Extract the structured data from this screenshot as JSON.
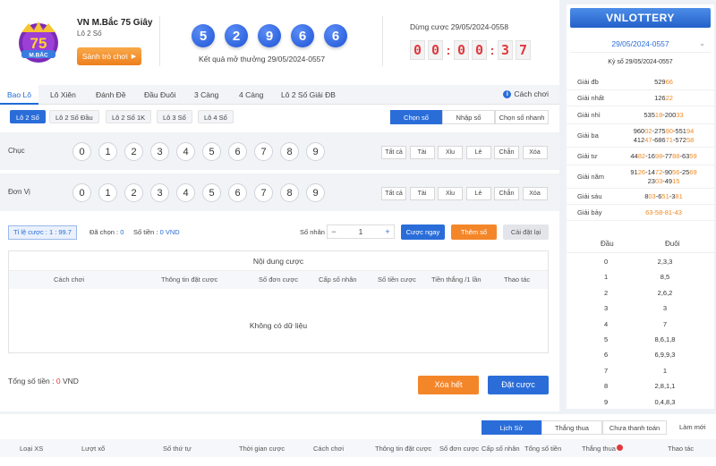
{
  "header": {
    "game_title": "VN M.Bắc 75 Giây",
    "game_sub": "Lô 2 Số",
    "lobby_btn": "Sảnh trò chơi",
    "logo_text": "75",
    "logo_sub": "M.BẮC",
    "balls": [
      "5",
      "2",
      "9",
      "6",
      "6"
    ],
    "result_text": "Kết quả mở thưởng 29/05/2024-0557",
    "stop_label": "Dừng cược 29/05/2024-0558",
    "countdown": [
      "0",
      "0",
      "0",
      "0",
      "3",
      "7"
    ]
  },
  "tabs": [
    {
      "label": "Bao Lô",
      "active": true
    },
    {
      "label": "Lô Xiên"
    },
    {
      "label": "Đánh Đề"
    },
    {
      "label": "Đầu Đuôi"
    },
    {
      "label": "3 Càng"
    },
    {
      "label": "4 Càng"
    },
    {
      "label": "Lô 2 Số Giải ĐB"
    }
  ],
  "howto": "Cách chơi",
  "subtabs": [
    {
      "label": "Lô 2 Số",
      "active": true
    },
    {
      "label": "Lô 2 Số Đầu"
    },
    {
      "label": "Lô 2 Số 1K"
    },
    {
      "label": "Lô 3 Số"
    },
    {
      "label": "Lô 4 Số"
    }
  ],
  "modes": [
    {
      "label": "Chọn số",
      "active": true
    },
    {
      "label": "Nhập số"
    },
    {
      "label": "Chọn số nhanh"
    }
  ],
  "rows": [
    {
      "label": "Chục",
      "numbers": [
        "0",
        "1",
        "2",
        "3",
        "4",
        "5",
        "6",
        "7",
        "8",
        "9"
      ]
    },
    {
      "label": "Đơn Vị",
      "numbers": [
        "0",
        "1",
        "2",
        "3",
        "4",
        "5",
        "6",
        "7",
        "8",
        "9"
      ]
    }
  ],
  "quick_buttons": [
    "Tất cả",
    "Tài",
    "Xỉu",
    "Lẻ",
    "Chẵn",
    "Xóa"
  ],
  "controls": {
    "ratio": "Tỉ lệ cược : 1 : 99.7",
    "selected_label": "Đã chọn : ",
    "selected_val": "0",
    "amount_label": "Số tiền : ",
    "amount_val": "0 VND",
    "multiplier_label": "Số nhân :",
    "minus": "−",
    "multiplier": "1",
    "plus": "+",
    "bet_now": "Cược ngay",
    "add_number": "Thêm số",
    "reset": "Cài đặt lại"
  },
  "content": {
    "title": "Nội dung cược",
    "headers": [
      "Cách chơi",
      "Thông tin đặt cược",
      "Số đơn cược",
      "Cấp số nhân",
      "Số tiền cược",
      "Tiền thắng /1 lần",
      "Thao tác"
    ],
    "empty": "Không có dữ liệu"
  },
  "footer": {
    "total_label": "Tổng số tiền : ",
    "total_val": "0",
    "total_unit": " VND",
    "clear_all": "Xóa hết",
    "place_bet": "Đặt cược"
  },
  "right": {
    "logo": "VNLOTTERY",
    "date": "29/05/2024-0557",
    "kyso": "Kỳ số 29/05/2024-0557",
    "prizes": [
      {
        "name": "Giải đb",
        "lines": [
          [
            [
              "529",
              ""
            ],
            [
              "66",
              "hl"
            ]
          ]
        ]
      },
      {
        "name": "Giải nhất",
        "lines": [
          [
            [
              "126",
              ""
            ],
            [
              "22",
              "hl"
            ]
          ]
        ]
      },
      {
        "name": "Giải nhì",
        "lines": [
          [
            [
              "535",
              ""
            ],
            [
              "18",
              "hl"
            ],
            [
              "-",
              ""
            ],
            [
              "200",
              ""
            ],
            [
              "33",
              "hl"
            ]
          ]
        ]
      },
      {
        "name": "Giải ba",
        "lines": [
          [
            [
              "960",
              ""
            ],
            [
              "02",
              "hl"
            ],
            [
              "-",
              ""
            ],
            [
              "275",
              ""
            ],
            [
              "90",
              "hl"
            ],
            [
              "-",
              ""
            ],
            [
              "551",
              ""
            ],
            [
              "94",
              "hl"
            ]
          ],
          [
            [
              "412",
              ""
            ],
            [
              "47",
              "hl"
            ],
            [
              "-",
              ""
            ],
            [
              "686",
              ""
            ],
            [
              "71",
              "hl"
            ],
            [
              "-",
              ""
            ],
            [
              "572",
              ""
            ],
            [
              "58",
              "hl"
            ]
          ]
        ]
      },
      {
        "name": "Giải tư",
        "lines": [
          [
            [
              "44",
              ""
            ],
            [
              "82",
              "hl"
            ],
            [
              "-",
              ""
            ],
            [
              "16",
              ""
            ],
            [
              "98",
              "hl"
            ],
            [
              "-",
              ""
            ],
            [
              "77",
              ""
            ],
            [
              "88",
              "hl"
            ],
            [
              "-",
              ""
            ],
            [
              "63",
              ""
            ],
            [
              "59",
              "hl"
            ]
          ]
        ]
      },
      {
        "name": "Giải năm",
        "lines": [
          [
            [
              "91",
              ""
            ],
            [
              "26",
              "hl"
            ],
            [
              "-",
              ""
            ],
            [
              "14",
              ""
            ],
            [
              "72",
              "hl"
            ],
            [
              "-",
              ""
            ],
            [
              "90",
              ""
            ],
            [
              "56",
              "hl"
            ],
            [
              "-",
              ""
            ],
            [
              "25",
              ""
            ],
            [
              "69",
              "hl"
            ]
          ],
          [
            [
              "23",
              ""
            ],
            [
              "03",
              "hl"
            ],
            [
              "-",
              ""
            ],
            [
              "49",
              ""
            ],
            [
              "15",
              "hl"
            ]
          ]
        ]
      },
      {
        "name": "Giải sáu",
        "lines": [
          [
            [
              "8",
              ""
            ],
            [
              "03",
              "hl"
            ],
            [
              "-",
              ""
            ],
            [
              "6",
              ""
            ],
            [
              "51",
              "hl"
            ],
            [
              "-",
              ""
            ],
            [
              "3",
              ""
            ],
            [
              "81",
              "hl"
            ]
          ]
        ]
      },
      {
        "name": "Giải bảy",
        "lines": [
          [
            [
              "63-58-81-43",
              "hl"
            ]
          ]
        ]
      }
    ],
    "headtail_head": "Đầu",
    "headtail_tail": "Đuôi",
    "headtail": [
      [
        "0",
        "2,3,3"
      ],
      [
        "1",
        "8,5"
      ],
      [
        "2",
        "2,6,2"
      ],
      [
        "3",
        "3"
      ],
      [
        "4",
        "7"
      ],
      [
        "5",
        "8,6,1,8"
      ],
      [
        "6",
        "6,9,9,3"
      ],
      [
        "7",
        "1"
      ],
      [
        "8",
        "2,8,1,1"
      ],
      [
        "9",
        "0,4,8,3"
      ]
    ]
  },
  "history": {
    "tabs": [
      {
        "label": "Lịch Sử",
        "active": true
      },
      {
        "label": "Thắng thua"
      },
      {
        "label": "Chưa thanh toán"
      }
    ],
    "refresh": "Làm mới",
    "headers": [
      "Loại XS",
      "Lượt xổ",
      "Số thứ tự",
      "Thời gian cược",
      "Cách chơi",
      "Thông tin đặt cược",
      "Số đơn cược",
      "Cấp số nhân",
      "Tổng số tiền",
      "Thắng thua",
      "Thao tác"
    ]
  },
  "colors": {
    "accent": "#2a6dd9",
    "orange": "#f4862a",
    "red": "#e0393e",
    "highlight": "#f08a24"
  }
}
